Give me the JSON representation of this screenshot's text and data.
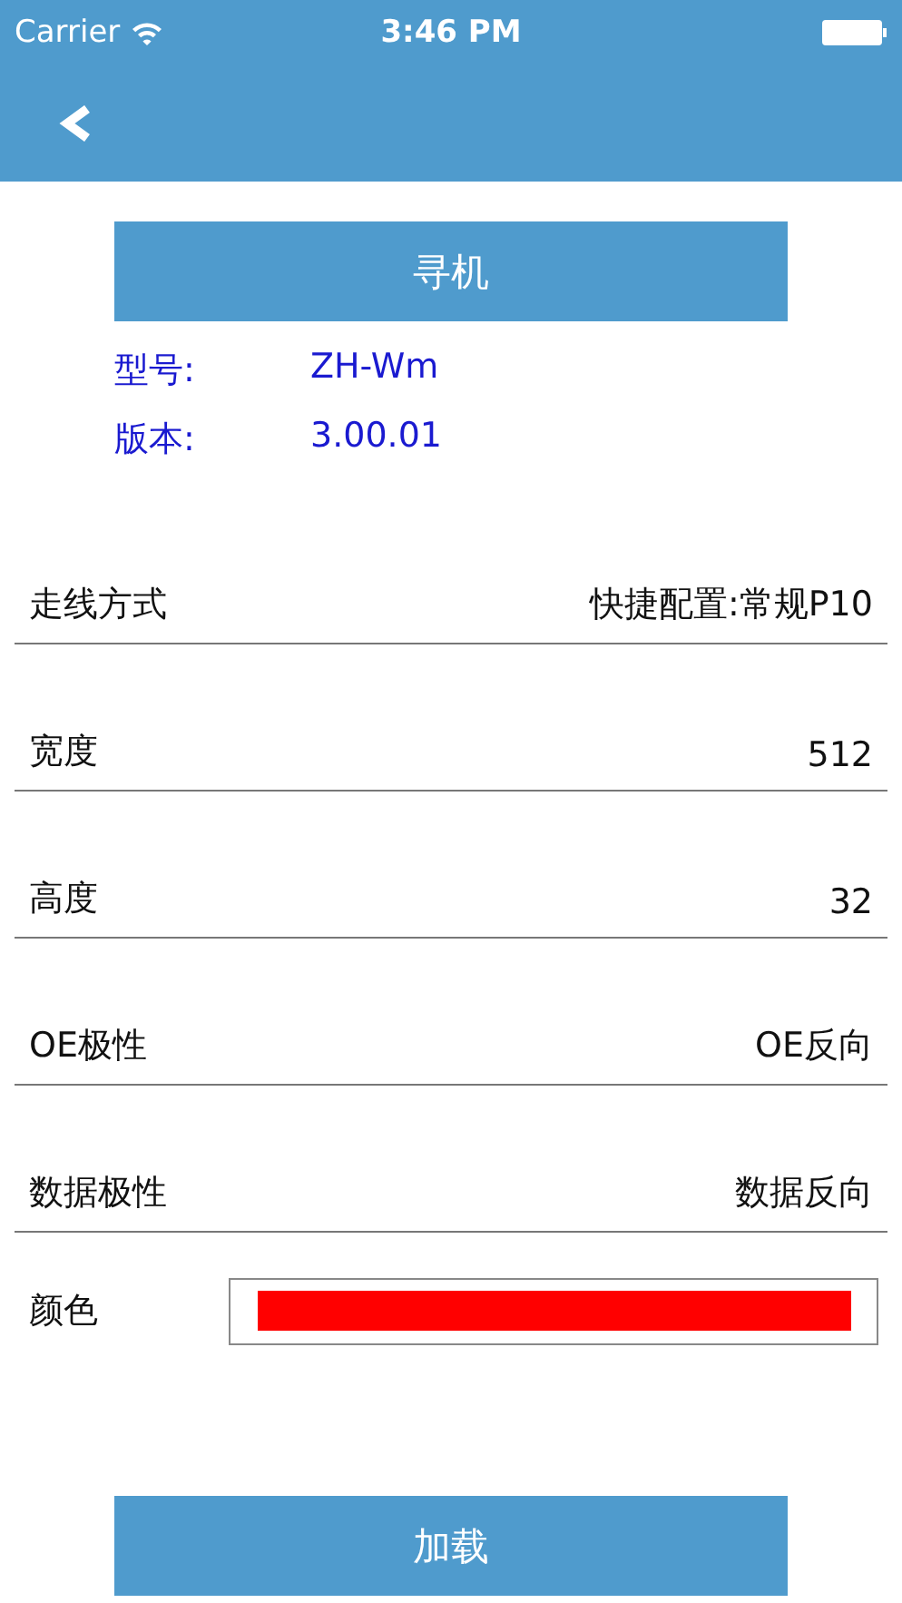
{
  "status_bar": {
    "carrier": "Carrier",
    "time": "3:46 PM"
  },
  "search_button": "寻机",
  "device_info": [
    {
      "label": "型号:",
      "value": "ZH-Wm"
    },
    {
      "label": "版本:",
      "value": "3.00.01"
    }
  ],
  "settings": [
    {
      "kind": "text",
      "label": "走线方式",
      "value": "快捷配置:常规P10"
    },
    {
      "kind": "text",
      "label": "宽度",
      "value": "512"
    },
    {
      "kind": "text",
      "label": "高度",
      "value": "32"
    },
    {
      "kind": "text",
      "label": "OE极性",
      "value": "OE反向"
    },
    {
      "kind": "text",
      "label": "数据极性",
      "value": "数据反向"
    },
    {
      "kind": "color",
      "label": "颜色",
      "color": "#ff0000"
    }
  ],
  "load_button": "加载"
}
